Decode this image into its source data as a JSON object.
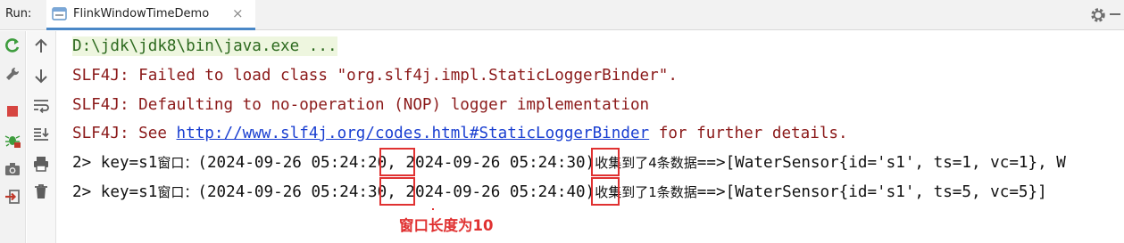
{
  "run_panel": {
    "label": "Run:",
    "tab_title": "FlinkWindowTimeDemo",
    "tab_close": "×"
  },
  "console": {
    "cmd": "D:\\jdk\\jdk8\\bin\\java.exe ...",
    "slf4j_1": "SLF4J: Failed to load class \"org.slf4j.impl.StaticLoggerBinder\".",
    "slf4j_2": "SLF4J: Defaulting to no-operation (NOP) logger implementation",
    "slf4j_3_prefix": "SLF4J: See ",
    "slf4j_3_link": "http://www.slf4j.org/codes.html#StaticLoggerBinder",
    "slf4j_3_suffix": " for further details.",
    "out1": {
      "p1": "2> key=s1",
      "w1": "窗口：",
      "p2": "(2024-09-26 05:24:20, 2024-09-26 05:24:30)",
      "w2": "收集到了4条数据",
      "p3": "==>[WaterSensor{id='s1', ts=1, vc=1}, W"
    },
    "out2": {
      "p1": "2> key=s1",
      "w1": "窗口：",
      "p2": "(2024-09-26 05:24:30, 2024-09-26 05:24:40)",
      "w2": "收集到了1条数据",
      "p3": "==>[WaterSensor{id='s1', ts=5, vc=5}]"
    }
  },
  "annotation": "窗口长度为10",
  "toolbar_icons": [
    "rerun-icon",
    "scroll-up-icon",
    "wrench-icon",
    "scroll-down-icon",
    "stop-icon",
    "soft-wrap-icon",
    "debug-icon",
    "scroll-to-end-icon",
    "camera-icon",
    "print-icon",
    "exit-icon",
    "trash-icon"
  ],
  "colors": {
    "error_text": "#8b1a1a",
    "command_text": "#2d6a1f",
    "link": "#1a3fd1",
    "annotation_red": "#e03131",
    "tab_underline": "#4a88c7"
  }
}
